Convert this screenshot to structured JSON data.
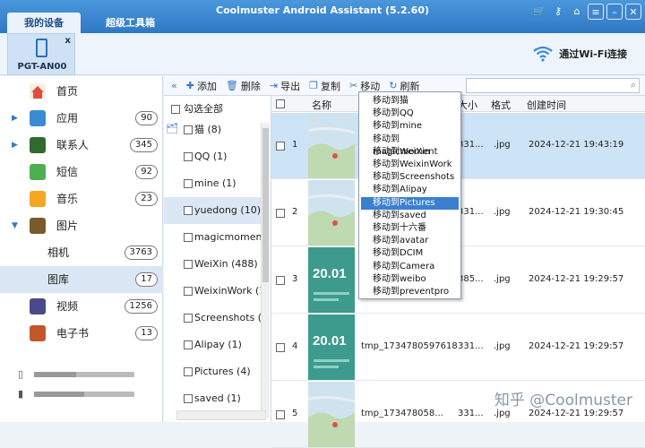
{
  "app": {
    "title": "Coolmuster Android Assistant (5.2.60)",
    "tabs": [
      "我的设备",
      "超级工具箱"
    ]
  },
  "device": {
    "name": "PGT-AN00",
    "close": "x",
    "wifi_label": "通过Wi-Fi连接"
  },
  "sidebar": {
    "items": [
      {
        "label": "首页",
        "count": null
      },
      {
        "label": "应用",
        "count": "90"
      },
      {
        "label": "联系人",
        "count": "345"
      },
      {
        "label": "短信",
        "count": "92"
      },
      {
        "label": "音乐",
        "count": "23"
      },
      {
        "label": "图片",
        "count": null
      },
      {
        "label": "相机",
        "count": "3763"
      },
      {
        "label": "图库",
        "count": "17"
      },
      {
        "label": "视频",
        "count": "1256"
      },
      {
        "label": "电子书",
        "count": "13"
      }
    ],
    "storage": [
      0.42,
      0.5
    ]
  },
  "toolbar": {
    "add": "添加",
    "delete": "删除",
    "export": "导出",
    "copy": "复制",
    "move": "移动",
    "refresh": "刷新",
    "search_placeholder": ""
  },
  "albums": {
    "select_all": "勾选全部",
    "items": [
      "猫 (8)",
      "QQ (1)",
      "mine (1)",
      "yuedong (10)",
      "magicmoment (1",
      "WeiXin (488)",
      "WeixinWork (1)",
      "Screenshots (14!",
      "Alipay (1)",
      "Pictures (4)",
      "saved (1)"
    ]
  },
  "grid": {
    "headers": {
      "name": "名称",
      "size": "大小",
      "format": "格式",
      "created": "创建时间"
    },
    "rows": [
      {
        "num": "1",
        "name": "",
        "size": "331...",
        "format": ".jpg",
        "date": "2024-12-21 19:43:19"
      },
      {
        "num": "2",
        "name": "",
        "size": "331...",
        "format": ".jpg",
        "date": "2024-12-21 19:30:45"
      },
      {
        "num": "3",
        "name": "5",
        "size": "385...",
        "format": ".jpg",
        "date": "2024-12-21 19:29:57"
      },
      {
        "num": "4",
        "name": "tmp_1734780597618",
        "size": "331...",
        "format": ".jpg",
        "date": "2024-12-21 19:29:57"
      },
      {
        "num": "5",
        "name": "tmp_173478058...",
        "size": "331...",
        "format": ".jpg",
        "date": "2024-12-21 19:29:57"
      }
    ],
    "thumb_text": [
      "20.01",
      "20.01"
    ]
  },
  "move_menu": {
    "items": [
      "移动到猫",
      "移动到QQ",
      "移动到mine",
      "移动到magicmoment",
      "移动到WeiXin",
      "移动到WeixinWork",
      "移动到Screenshots",
      "移动到Alipay",
      "移动到Pictures",
      "移动到saved",
      "移动到十六番",
      "移动到avatar",
      "移动到DCIM",
      "移动到Camera",
      "移动到weibo",
      "移动到preventpro"
    ],
    "highlighted": 8
  },
  "watermark": "知乎 @Coolmuster"
}
